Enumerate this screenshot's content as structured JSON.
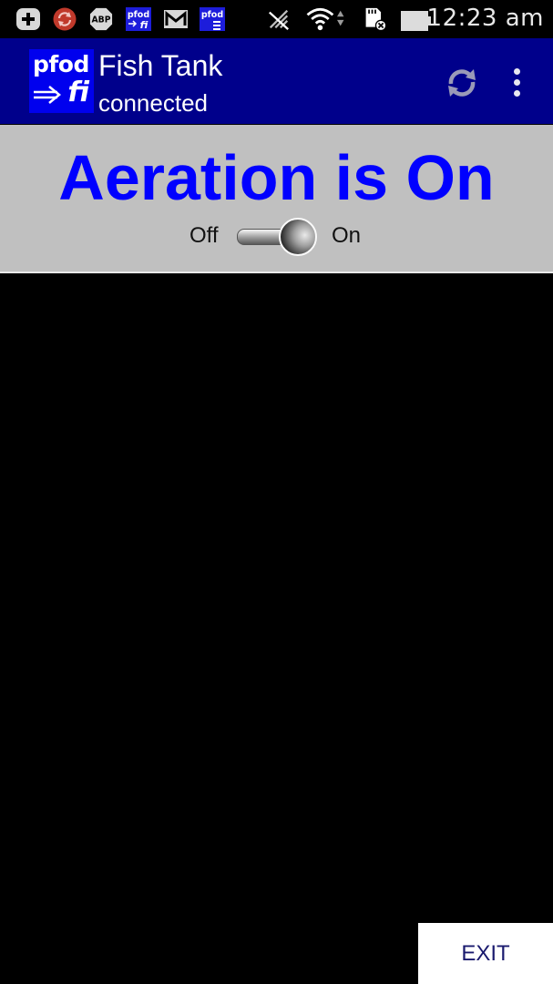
{
  "status_bar": {
    "time": "12:23 am",
    "notification_icons": [
      "add-icon",
      "sync-app-icon",
      "abp-icon",
      "pfodfi-notification-icon",
      "gmail-icon",
      "pfod-notification-icon"
    ],
    "abp_label": "ABP",
    "pfod_label": "pfod",
    "system_icons": [
      "no-data-icon",
      "wifi-icon",
      "sdcard-error-icon",
      "battery-icon"
    ]
  },
  "app_bar": {
    "logo_top": "pfod",
    "logo_bottom": "fi",
    "title": "Fish Tank",
    "subtitle": "connected",
    "background_color": "#00008b",
    "logo_color": "#0000ee"
  },
  "panel": {
    "title": "Aeration is On",
    "title_color": "#0000ff",
    "background_color": "#c0c0c0",
    "toggle": {
      "off_label": "Off",
      "on_label": "On",
      "state": "on"
    }
  },
  "footer": {
    "exit_label": "EXIT"
  }
}
